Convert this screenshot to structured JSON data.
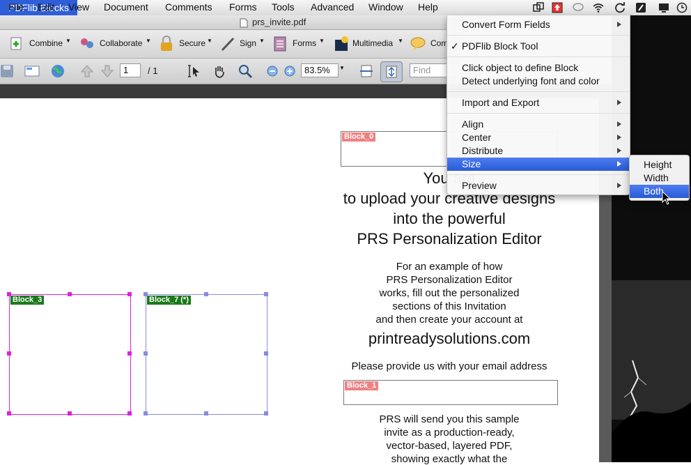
{
  "menubar": {
    "items": [
      "File",
      "Edit",
      "View",
      "Document",
      "Comments",
      "Forms",
      "Tools",
      "Advanced",
      "Window",
      "Help"
    ],
    "active": "PDFlib Blocks"
  },
  "window": {
    "title": "prs_invite.pdf"
  },
  "toolbar1": {
    "combine": "Combine",
    "collaborate": "Collaborate",
    "secure": "Secure",
    "sign": "Sign",
    "forms": "Forms",
    "multimedia": "Multimedia",
    "comment": "Com"
  },
  "toolbar2": {
    "page_current": "1",
    "page_total": "/ 1",
    "zoom": "83.5%",
    "find_placeholder": "Find"
  },
  "dropdown": {
    "convert": "Convert Form Fields",
    "blocktool": "PDFlib Block Tool",
    "click": "Click object to define Block",
    "detect": "Detect underlying font and color",
    "import": "Import and Export",
    "align": "Align",
    "center": "Center",
    "distribute": "Distribute",
    "size": "Size",
    "preview": "Preview",
    "check": "✓"
  },
  "submenu": {
    "height": "Height",
    "width": "Width",
    "both": "Both"
  },
  "document": {
    "block0": "Block_0",
    "block1": "Block_1",
    "block3": "Block_3",
    "block7": "Block_7 (*)",
    "line1": "You are",
    "line2": "to upload your creative designs",
    "line3": "into the powerful",
    "line4": "PRS Personalization Editor",
    "p1": "For an example of how",
    "p2": "PRS Personalization Editor",
    "p3": "works, fill out the personalized",
    "p4": "sections of this Invitation",
    "p5": "and then create your account at",
    "url": "printreadysolutions.com",
    "email_prompt": "Please provide us with your email address",
    "q1": "PRS will send you this sample",
    "q2": "invite as a production-ready,",
    "q3": "vector-based, layered PDF,",
    "q4": "showing exactly what the"
  },
  "colors": {
    "accent": "#2f5fd8",
    "block_red": "#f08080",
    "block_green": "#1a7a1a",
    "magenta": "#e020e0",
    "lavender": "#8a8ae0"
  }
}
